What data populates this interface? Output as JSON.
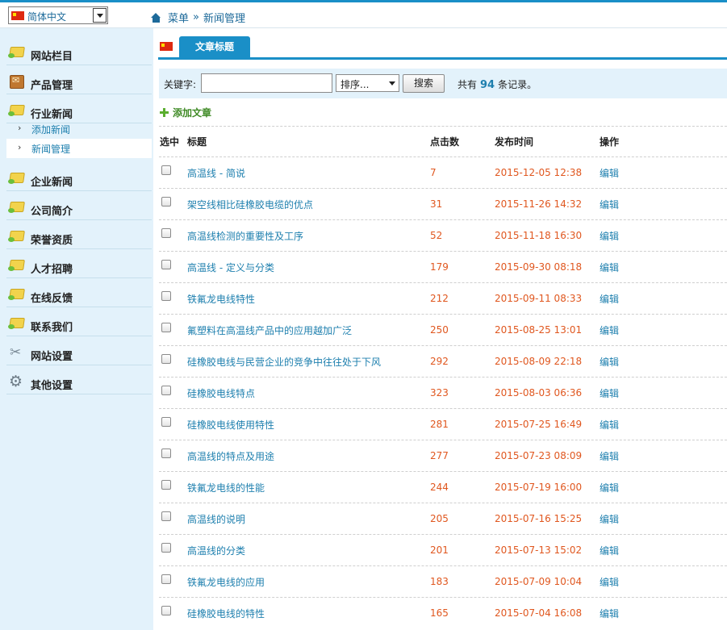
{
  "language": {
    "selected": "简体中文"
  },
  "breadcrumb": {
    "root": "菜单",
    "separator": "»",
    "current": "新闻管理"
  },
  "sidebar": {
    "groups": [
      {
        "label": "网站栏目",
        "icon": "folder-icon"
      },
      {
        "label": "产品管理",
        "icon": "box-icon"
      },
      {
        "label": "行业新闻",
        "icon": "folder-icon"
      },
      {
        "label": "企业新闻",
        "icon": "folder-icon"
      },
      {
        "label": "公司简介",
        "icon": "folder-icon"
      },
      {
        "label": "荣誉资质",
        "icon": "folder-icon"
      },
      {
        "label": "人才招聘",
        "icon": "folder-icon"
      },
      {
        "label": "在线反馈",
        "icon": "folder-icon"
      },
      {
        "label": "联系我们",
        "icon": "folder-icon"
      },
      {
        "label": "网站设置",
        "icon": "tools-icon"
      },
      {
        "label": "其他设置",
        "icon": "gear-icon"
      }
    ],
    "subitems": [
      {
        "label": "添加新闻",
        "active": false
      },
      {
        "label": "新闻管理",
        "active": true
      }
    ],
    "arrow": "›"
  },
  "tab": {
    "label": "文章标题"
  },
  "search": {
    "label": "关键字:",
    "value": "",
    "sort_label": "排序...",
    "button": "搜索",
    "count_prefix": "共有",
    "count": "94",
    "count_suffix": "条记录。"
  },
  "add_article": "添加文章",
  "table": {
    "headers": {
      "select": "选中",
      "title": "标题",
      "clicks": "点击数",
      "time": "发布时间",
      "op": "操作"
    },
    "rows": [
      {
        "title": "高温线 - 简说",
        "clicks": "7",
        "time": "2015-12-05 12:38",
        "op": "编辑"
      },
      {
        "title": "架空线相比硅橡胶电缆的优点",
        "clicks": "31",
        "time": "2015-11-26 14:32",
        "op": "编辑"
      },
      {
        "title": "高温线检测的重要性及工序",
        "clicks": "52",
        "time": "2015-11-18 16:30",
        "op": "编辑"
      },
      {
        "title": "高温线 - 定义与分类",
        "clicks": "179",
        "time": "2015-09-30 08:18",
        "op": "编辑"
      },
      {
        "title": "铁氟龙电线特性",
        "clicks": "212",
        "time": "2015-09-11 08:33",
        "op": "编辑"
      },
      {
        "title": "氟塑料在高温线产品中的应用越加广泛",
        "clicks": "250",
        "time": "2015-08-25 13:01",
        "op": "编辑"
      },
      {
        "title": "硅橡胶电线与民营企业的竞争中往往处于下风",
        "clicks": "292",
        "time": "2015-08-09 22:18",
        "op": "编辑"
      },
      {
        "title": "硅橡胶电线特点",
        "clicks": "323",
        "time": "2015-08-03 06:36",
        "op": "编辑"
      },
      {
        "title": "硅橡胶电线使用特性",
        "clicks": "281",
        "time": "2015-07-25 16:49",
        "op": "编辑"
      },
      {
        "title": "高温线的特点及用途",
        "clicks": "277",
        "time": "2015-07-23 08:09",
        "op": "编辑"
      },
      {
        "title": "铁氟龙电线的性能",
        "clicks": "244",
        "time": "2015-07-19 16:00",
        "op": "编辑"
      },
      {
        "title": "高温线的说明",
        "clicks": "205",
        "time": "2015-07-16 15:25",
        "op": "编辑"
      },
      {
        "title": "高温线的分类",
        "clicks": "201",
        "time": "2015-07-13 15:02",
        "op": "编辑"
      },
      {
        "title": "铁氟龙电线的应用",
        "clicks": "183",
        "time": "2015-07-09 10:04",
        "op": "编辑"
      },
      {
        "title": "硅橡胶电线的特性",
        "clicks": "165",
        "time": "2015-07-04 16:08",
        "op": "编辑"
      }
    ]
  },
  "colors": {
    "accent": "#1a8fc7",
    "sidebar_bg": "#e3f2fb",
    "link": "#1d7fae",
    "value": "#e0571f",
    "add": "#3f8a25"
  }
}
